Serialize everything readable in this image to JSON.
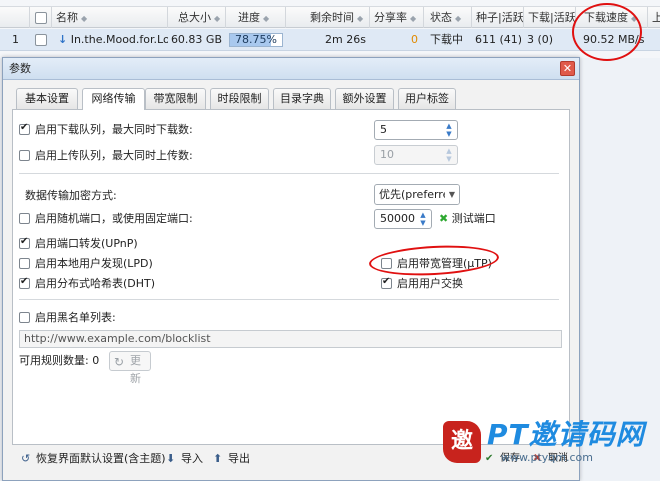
{
  "table": {
    "columns": [
      "名称",
      "总大小",
      "进度",
      "剩余时间",
      "分享率",
      "状态",
      "种子|活跃",
      "下载|活跃",
      "下载速度",
      "上"
    ],
    "row": {
      "index": "1",
      "name": "In.the.Mood.for.Lo",
      "size": "60.83 GB",
      "progress_text": "78.75%",
      "progress": 0.7875,
      "eta": "2m 26s",
      "ratio": "0",
      "status": "下载中",
      "seeds": "611 (41)",
      "peers": "3 (0)",
      "dl_speed": "90.52 MB/s"
    }
  },
  "dialog": {
    "title": "参数",
    "close_glyph": "✕",
    "tabs": [
      "基本设置",
      "网络传输",
      "带宽限制",
      "时段限制",
      "目录字典",
      "额外设置",
      "用户标签"
    ],
    "active_tab": 1,
    "queue": {
      "download_label": "启用下载队列，最大同时下载数:",
      "download_checked": true,
      "download_value": "5",
      "upload_label": "启用上传队列，最大同时上传数:",
      "upload_checked": false,
      "upload_value": "10"
    },
    "encryption": {
      "label": "数据传输加密方式:",
      "value": "优先(preferre"
    },
    "port": {
      "label": "启用随机端口，或使用固定端口:",
      "checked": false,
      "value": "50000",
      "test_label": "测试端口"
    },
    "upnp": {
      "label": "启用端口转发(UPnP)",
      "checked": true
    },
    "lpd": {
      "label": "启用本地用户发现(LPD)",
      "checked": false
    },
    "dht": {
      "label": "启用分布式哈希表(DHT)",
      "checked": true
    },
    "utp": {
      "label": "启用带宽管理(µTP)",
      "checked": false
    },
    "pex": {
      "label": "启用用户交换",
      "checked": true
    },
    "blocklist": {
      "label": "启用黑名单列表:",
      "checked": false,
      "url": "http://www.example.com/blocklist",
      "count_label": "可用规则数量:",
      "count": "0",
      "update_label": "更新"
    },
    "footer": {
      "reset_label": "恢复界面默认设置(含主题)",
      "import_label": "导入",
      "export_label": "导出",
      "save_label": "保存",
      "cancel_label": "取消"
    }
  },
  "watermark": {
    "logo_char": "邀",
    "text": "PT邀请码网",
    "url": "www.ptyqm.com"
  },
  "colors": {
    "accent": "#3a7bc8",
    "annotation": "#e01010",
    "watermark_blue": "#1f8be0",
    "watermark_red": "#c8231d"
  }
}
